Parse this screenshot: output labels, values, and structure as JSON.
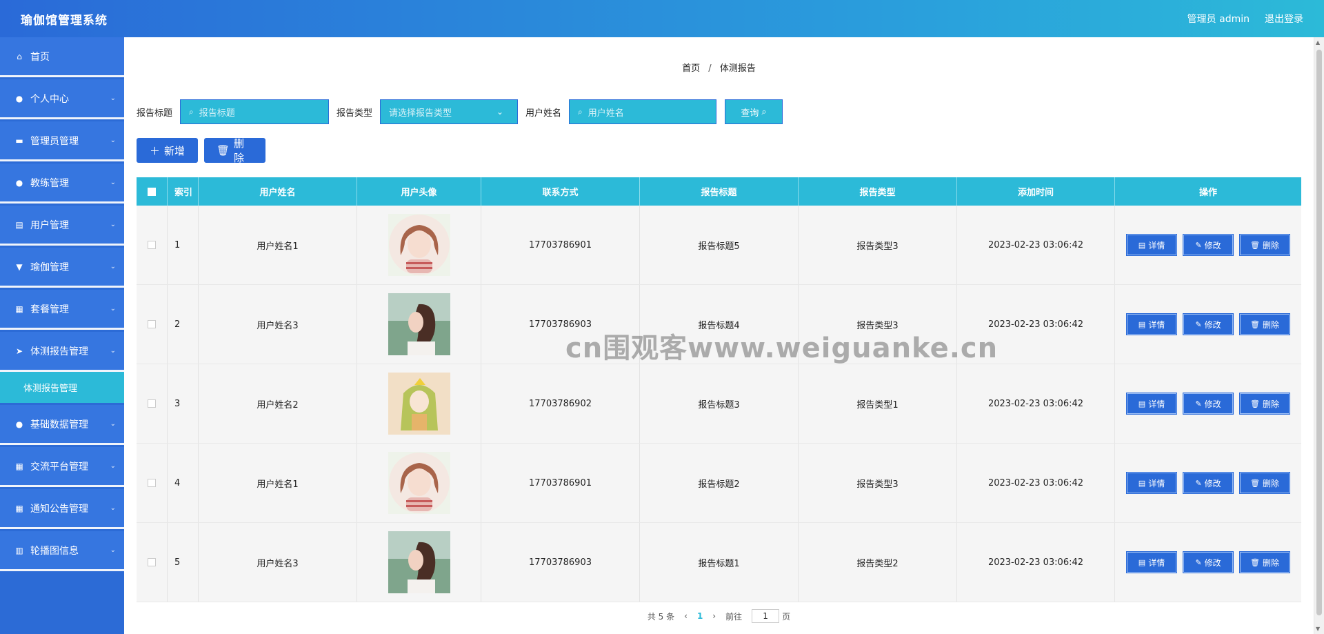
{
  "header": {
    "title": "瑜伽馆管理系统",
    "admin": "管理员 admin",
    "logout": "退出登录"
  },
  "sidebar": {
    "items": [
      {
        "label": "首页",
        "icon": "home-icon",
        "glyph": "⌂",
        "chevron": false
      },
      {
        "label": "个人中心",
        "icon": "user-icon",
        "glyph": "●",
        "chevron": true
      },
      {
        "label": "管理员管理",
        "icon": "monitor-icon",
        "glyph": "▬",
        "chevron": true
      },
      {
        "label": "教练管理",
        "icon": "user-icon",
        "glyph": "●",
        "chevron": true
      },
      {
        "label": "用户管理",
        "icon": "clipboard-icon",
        "glyph": "▤",
        "chevron": true
      },
      {
        "label": "瑜伽管理",
        "icon": "flag-icon",
        "glyph": "▼",
        "chevron": true
      },
      {
        "label": "套餐管理",
        "icon": "grid-icon",
        "glyph": "▦",
        "chevron": true
      },
      {
        "label": "体测报告管理",
        "icon": "send-icon",
        "glyph": "➤",
        "chevron": true
      },
      {
        "label": "基础数据管理",
        "icon": "bulb-icon",
        "glyph": "●",
        "chevron": true
      },
      {
        "label": "交流平台管理",
        "icon": "grid-icon",
        "glyph": "▦",
        "chevron": true
      },
      {
        "label": "通知公告管理",
        "icon": "grid-icon",
        "glyph": "▦",
        "chevron": true
      },
      {
        "label": "轮播图信息",
        "icon": "chart-icon",
        "glyph": "▥",
        "chevron": true
      }
    ],
    "submenu": "体测报告管理"
  },
  "breadcrumb": {
    "home": "首页",
    "sep": "/",
    "current": "体测报告"
  },
  "search": {
    "title_label": "报告标题",
    "title_placeholder": "报告标题",
    "type_label": "报告类型",
    "type_placeholder": "请选择报告类型",
    "name_label": "用户姓名",
    "name_placeholder": "用户姓名",
    "query": "查询"
  },
  "actions": {
    "add": "新增",
    "delete": "删除"
  },
  "table": {
    "headers": [
      "索引",
      "用户姓名",
      "用户头像",
      "联系方式",
      "报告标题",
      "报告类型",
      "添加时间",
      "操作"
    ],
    "rows": [
      {
        "index": "1",
        "name": "用户姓名1",
        "avatar": "avatar-girl-red",
        "phone": "17703786901",
        "title": "报告标题5",
        "type": "报告类型3",
        "time": "2023-02-23 03:06:42"
      },
      {
        "index": "2",
        "name": "用户姓名3",
        "avatar": "avatar-girl-profile",
        "phone": "17703786903",
        "title": "报告标题4",
        "type": "报告类型3",
        "time": "2023-02-23 03:06:42"
      },
      {
        "index": "3",
        "name": "用户姓名2",
        "avatar": "avatar-girl-green",
        "phone": "17703786902",
        "title": "报告标题3",
        "type": "报告类型1",
        "time": "2023-02-23 03:06:42"
      },
      {
        "index": "4",
        "name": "用户姓名1",
        "avatar": "avatar-girl-red",
        "phone": "17703786901",
        "title": "报告标题2",
        "type": "报告类型3",
        "time": "2023-02-23 03:06:42"
      },
      {
        "index": "5",
        "name": "用户姓名3",
        "avatar": "avatar-girl-profile",
        "phone": "17703786903",
        "title": "报告标题1",
        "type": "报告类型2",
        "time": "2023-02-23 03:06:42"
      }
    ],
    "row_actions": {
      "detail": "详情",
      "edit": "修改",
      "delete": "删除"
    }
  },
  "pagination": {
    "total": "共 5 条",
    "prev": "‹",
    "page": "1",
    "next": "›",
    "goto": "前往",
    "goto_value": "1",
    "unit": "页"
  },
  "watermark": "cn围观客www.weiguanke.cn",
  "colors": {
    "primary": "#2a6ad8",
    "accent": "#2cbad8",
    "row_bg": "#f5f5f5"
  }
}
